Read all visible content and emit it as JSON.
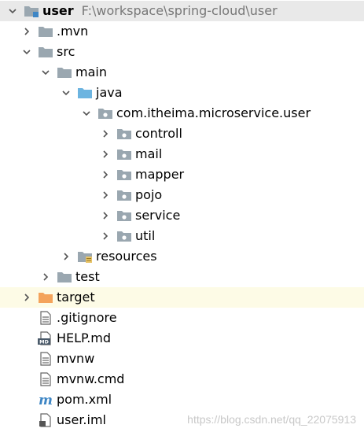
{
  "tree": {
    "root": {
      "label": "user",
      "path": "F:\\workspace\\spring-cloud\\user",
      "icon": "module-folder-icon",
      "expanded": true
    },
    "items": [
      {
        "label": ".mvn",
        "icon": "folder-icon",
        "expanded": false
      },
      {
        "label": "src",
        "icon": "folder-icon",
        "expanded": true
      },
      {
        "label": "main",
        "icon": "folder-icon",
        "expanded": true
      },
      {
        "label": "java",
        "icon": "source-folder-icon",
        "expanded": true
      },
      {
        "label": "com.itheima.microservice.user",
        "icon": "package-icon",
        "expanded": true
      },
      {
        "label": "controll",
        "icon": "package-icon",
        "expanded": false
      },
      {
        "label": "mail",
        "icon": "package-icon",
        "expanded": false
      },
      {
        "label": "mapper",
        "icon": "package-icon",
        "expanded": false
      },
      {
        "label": "pojo",
        "icon": "package-icon",
        "expanded": false
      },
      {
        "label": "service",
        "icon": "package-icon",
        "expanded": false
      },
      {
        "label": "util",
        "icon": "package-icon",
        "expanded": false
      },
      {
        "label": "resources",
        "icon": "resources-folder-icon",
        "expanded": false
      },
      {
        "label": "test",
        "icon": "folder-icon",
        "expanded": false
      },
      {
        "label": "target",
        "icon": "excluded-folder-icon",
        "expanded": false
      },
      {
        "label": ".gitignore",
        "icon": "text-file-icon"
      },
      {
        "label": "HELP.md",
        "icon": "markdown-file-icon"
      },
      {
        "label": "mvnw",
        "icon": "text-file-icon"
      },
      {
        "label": "mvnw.cmd",
        "icon": "text-file-icon"
      },
      {
        "label": "pom.xml",
        "icon": "maven-file-icon"
      },
      {
        "label": "user.iml",
        "icon": "iml-file-icon"
      }
    ]
  },
  "colors": {
    "folder": "#9aa7b0",
    "source_folder": "#6cb4e0",
    "excluded_folder": "#f4a35b",
    "selected_row": "#e9e9e9",
    "highlight_row": "#fdfbe6",
    "path_text": "#777777",
    "maven": "#3e86c5"
  },
  "watermark": "https://blog.csdn.net/qq_22075913"
}
